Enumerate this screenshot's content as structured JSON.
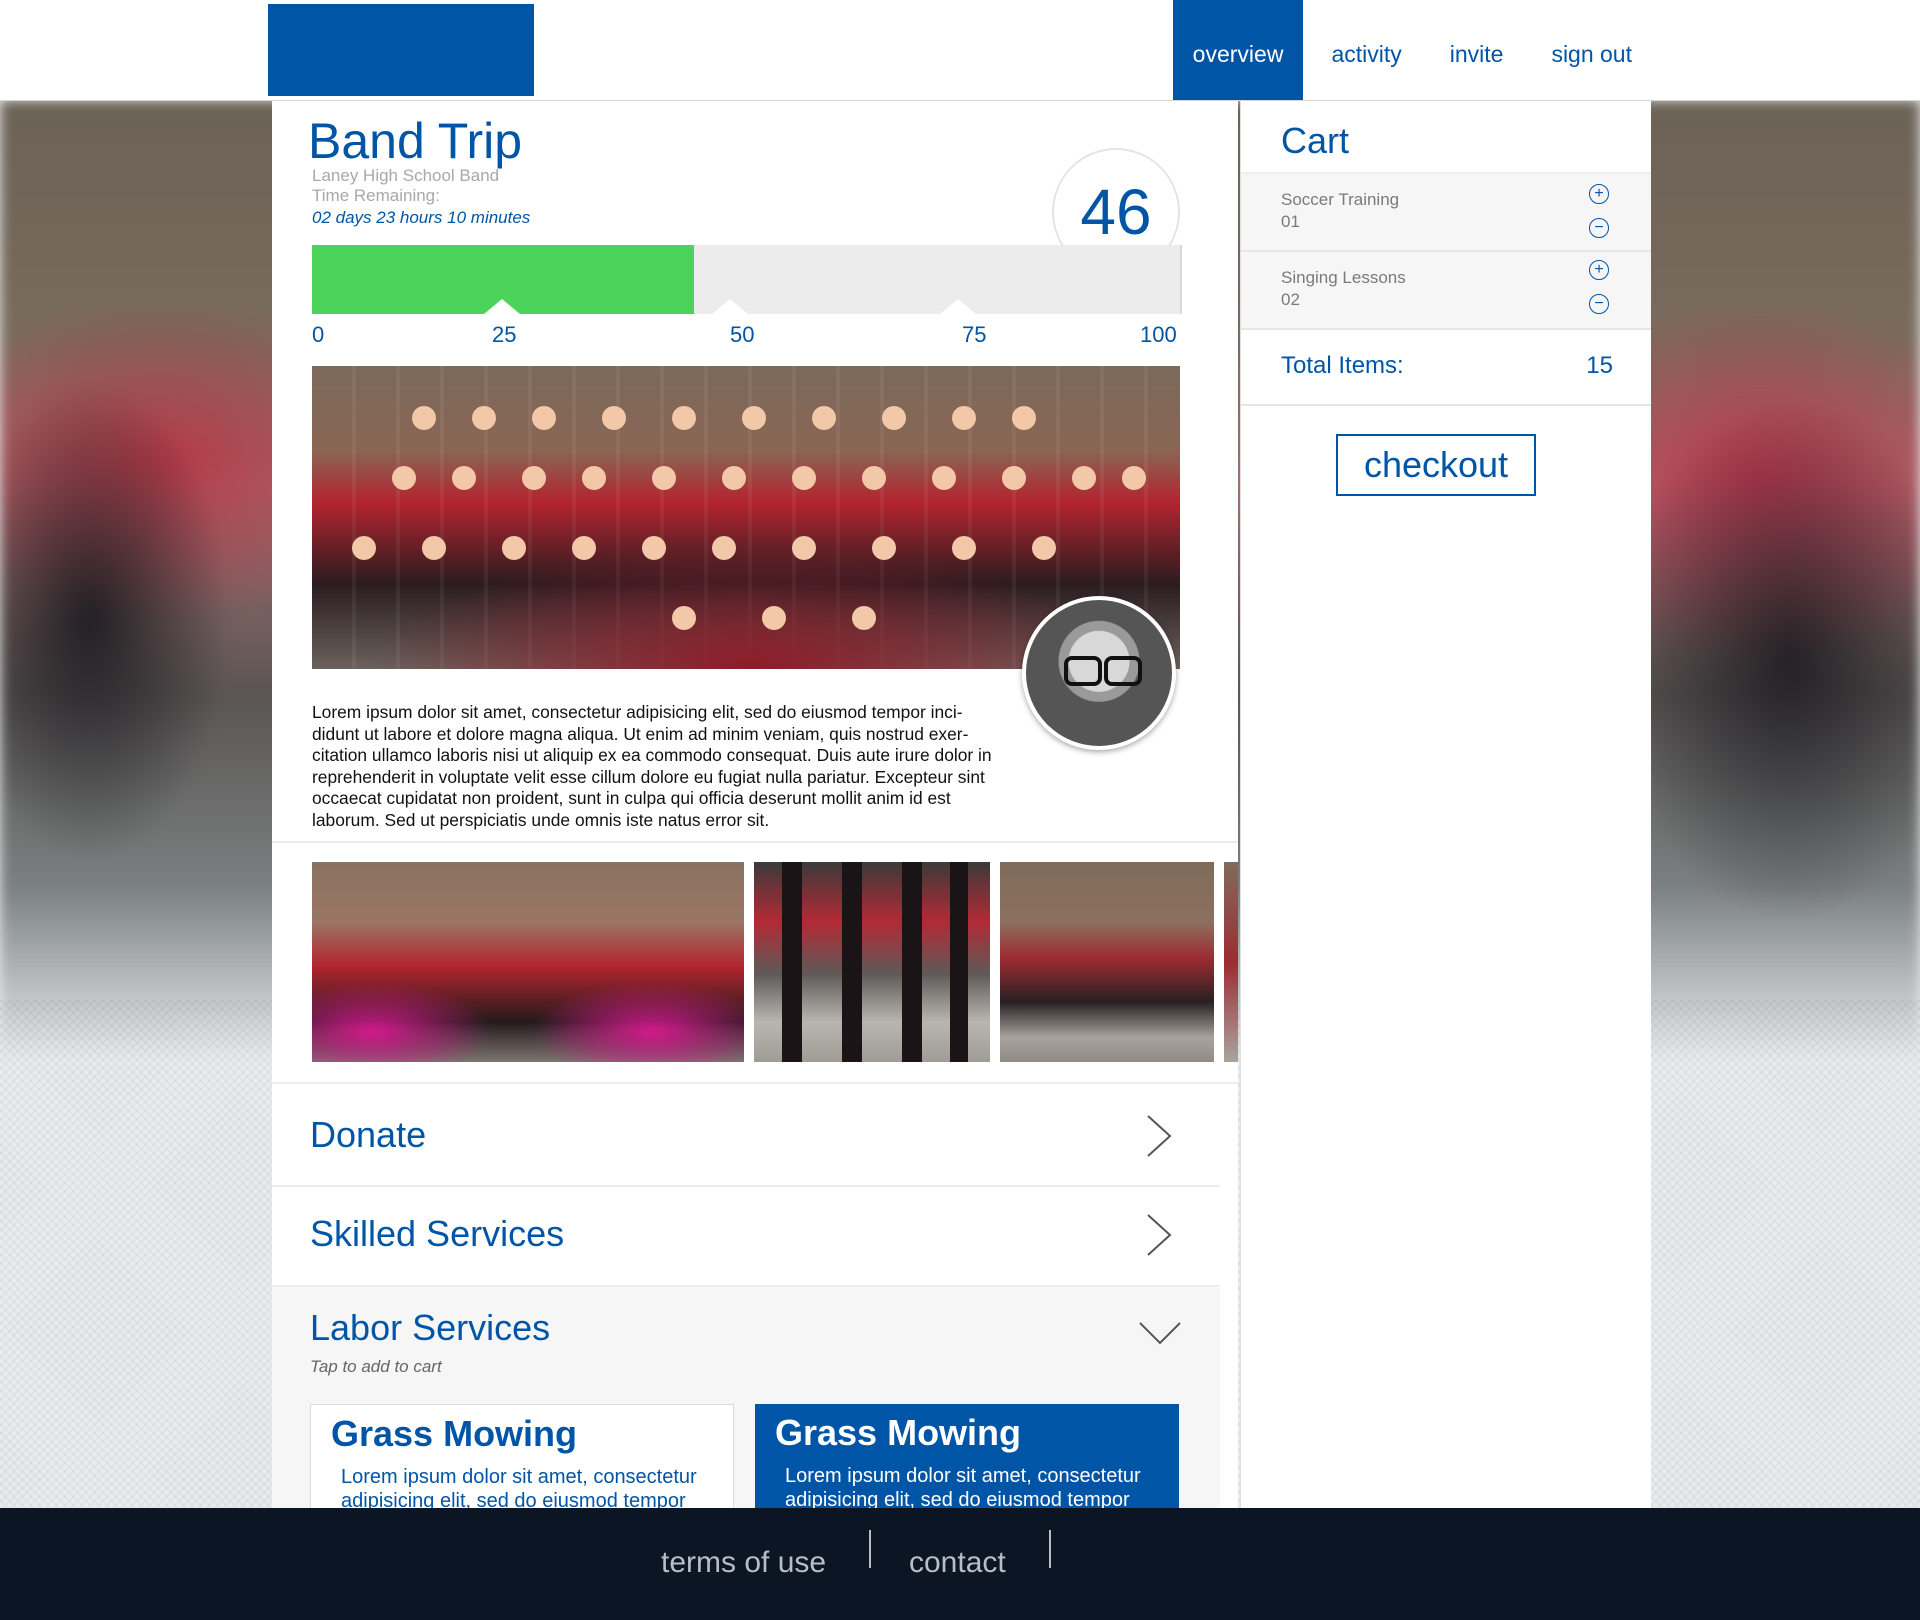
{
  "nav": {
    "items": [
      {
        "label": "overview",
        "active": true
      },
      {
        "label": "activity",
        "active": false
      },
      {
        "label": "invite",
        "active": false
      },
      {
        "label": "sign out",
        "active": false
      }
    ]
  },
  "campaign": {
    "title": "Band Trip",
    "organization": "Laney High School Band",
    "time_label": "Time Remaining:",
    "time_value": "02 days 23 hours 10 minutes",
    "count": "46",
    "progress_percent": 44,
    "scale": [
      "0",
      "25",
      "50",
      "75",
      "100"
    ],
    "description": "Lorem ipsum dolor sit amet, consectetur adipisicing elit, sed do eiusmod tempor inci-didunt ut labore et dolore magna aliqua. Ut enim ad minim veniam, quis nostrud exer-citation ullamco laboris nisi ut aliquip ex ea commodo consequat. Duis aute irure dolor in reprehenderit in voluptate velit esse cillum dolore eu fugiat nulla pariatur. Excepteur sint occaecat cupidatat non proident, sunt in culpa qui officia deserunt mollit anim id est laborum. Sed ut perspiciatis unde omnis iste natus error sit."
  },
  "sections": {
    "donate": "Donate",
    "skilled": "Skilled Services",
    "labor": "Labor Services",
    "tap_hint": "Tap to add to cart"
  },
  "services": [
    {
      "title": "Grass Mowing",
      "desc": "Lorem ipsum dolor sit amet, consectetur adipisicing elit, sed do eiusmod tempor",
      "selected": false
    },
    {
      "title": "Grass Mowing",
      "desc": "Lorem ipsum dolor sit amet, consectetur adipisicing elit, sed do eiusmod tempor",
      "selected": true
    }
  ],
  "cart": {
    "title": "Cart",
    "items": [
      {
        "name": "Soccer Training",
        "qty": "01"
      },
      {
        "name": "Singing Lessons",
        "qty": "02"
      }
    ],
    "total_label": "Total Items:",
    "total_value": "15",
    "checkout_label": "checkout"
  },
  "footer": {
    "links": [
      "terms of use",
      "contact"
    ]
  },
  "colors": {
    "brand_blue": "#0055a6",
    "progress_green": "#4cd45a",
    "footer_bg": "#0b1523"
  },
  "icons": {
    "chevron_right": "chevron-right-icon",
    "chevron_down": "chevron-down-icon",
    "plus": "plus-circle-icon",
    "minus": "minus-circle-icon"
  }
}
